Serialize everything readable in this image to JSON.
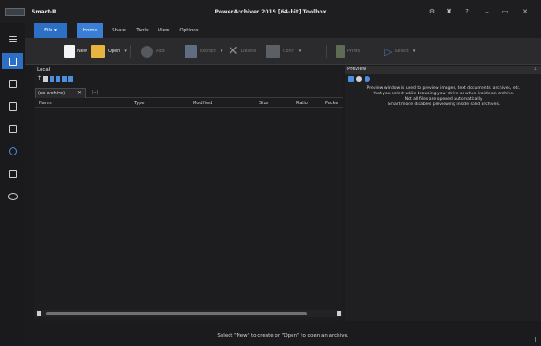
{
  "window": {
    "app_name": "Smart-R",
    "title": "PowerArchiver 2019 [64-bit] Toolbox",
    "controls": [
      "⚙",
      "♜",
      "?",
      "–",
      "▭",
      "✕"
    ]
  },
  "menu": {
    "items": [
      "File",
      "Home",
      "Share",
      "Tools",
      "View",
      "Options"
    ]
  },
  "toolbar": {
    "new": "New",
    "open": "Open",
    "add": "Add",
    "extract": "Extract",
    "delete": "Delete",
    "convert": "Conv",
    "view": "Prints",
    "select": "Select"
  },
  "local": {
    "caption": "Local",
    "tab_label": "(no archive)",
    "tab_close": "✕",
    "tab_add": "|+|",
    "columns": [
      "Name",
      "Type",
      "Modified",
      "Size",
      "Ratio",
      "Packe"
    ]
  },
  "preview": {
    "title": "Preview",
    "pin": "⊥",
    "lines": [
      "Preview window is used to preview images, text documents, archives, etc.",
      "that you select while browsing your drive or when inside an archive.",
      "Not all files are opened automatically.",
      "Smart mode disables previewing inside solid archives."
    ]
  },
  "status": {
    "text": "Select \"New\" to create or \"Open\" to open an archive."
  },
  "colors": {
    "accent": "#2c6fc5",
    "background": "#1b1b1d"
  }
}
